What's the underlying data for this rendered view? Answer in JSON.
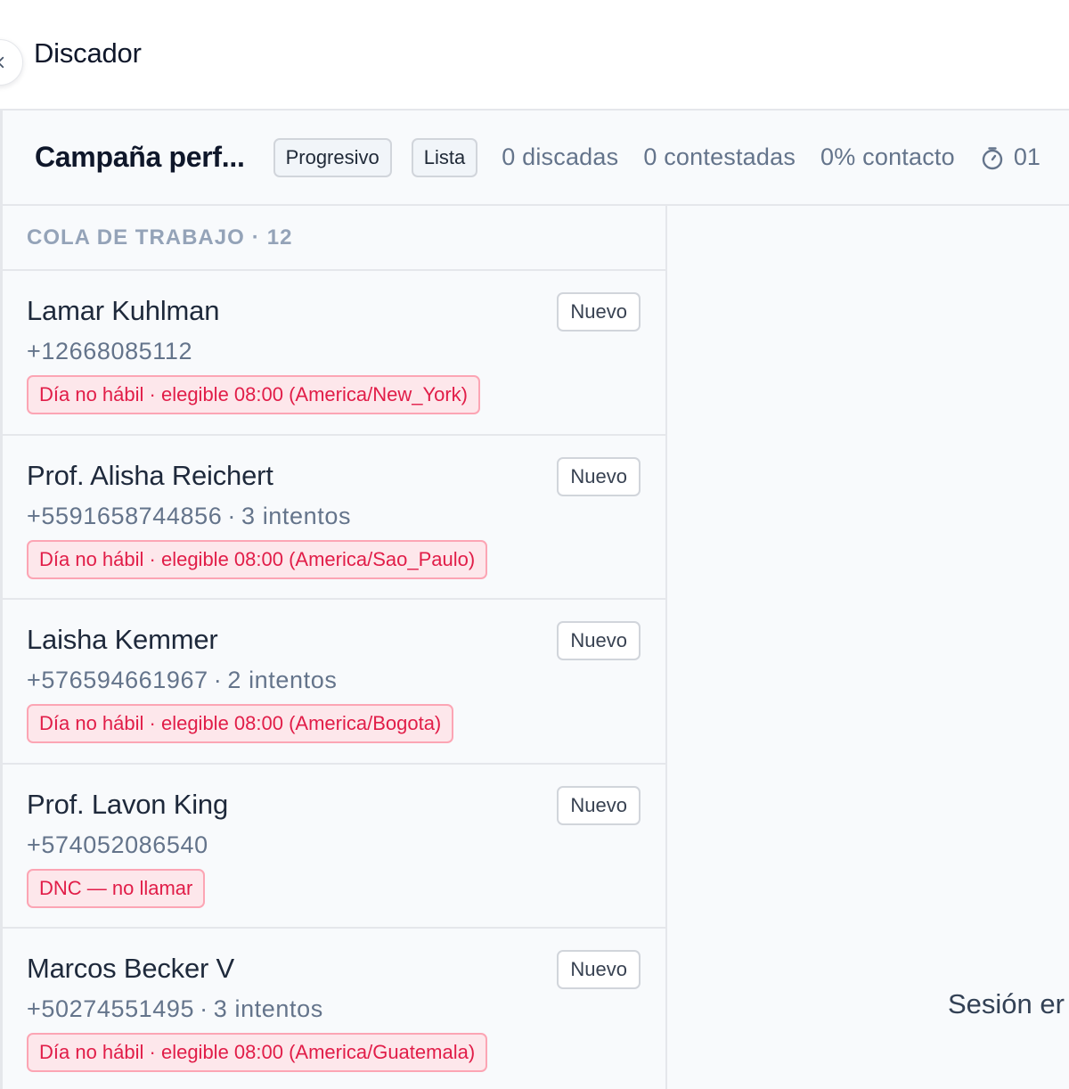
{
  "header": {
    "title": "Discador"
  },
  "campaign": {
    "name": "Campaña perf...",
    "mode": "Progresivo",
    "type": "Lista",
    "stats": {
      "dialed": "0 discadas",
      "answered": "0 contestadas",
      "contact_rate": "0% contacto",
      "timer": "01"
    }
  },
  "queue": {
    "title": "COLA DE TRABAJO",
    "separator": "·",
    "count": "12",
    "items": [
      {
        "name": "Lamar Kuhlman",
        "phone": "+12668085112",
        "attempts": "",
        "status": "Nuevo",
        "alert": "Día no hábil · elegible 08:00 (America/New_York)"
      },
      {
        "name": "Prof. Alisha Reichert",
        "phone": "+5591658744856",
        "attempts": "3 intentos",
        "status": "Nuevo",
        "alert": "Día no hábil · elegible 08:00 (America/Sao_Paulo)"
      },
      {
        "name": "Laisha Kemmer",
        "phone": "+576594661967",
        "attempts": "2 intentos",
        "status": "Nuevo",
        "alert": "Día no hábil · elegible 08:00 (America/Bogota)"
      },
      {
        "name": "Prof. Lavon King",
        "phone": "+574052086540",
        "attempts": "",
        "status": "Nuevo",
        "alert": "DNC — no llamar"
      },
      {
        "name": "Marcos Becker V",
        "phone": "+50274551495",
        "attempts": "3 intentos",
        "status": "Nuevo",
        "alert": "Día no hábil · elegible 08:00 (America/Guatemala)"
      }
    ]
  },
  "detail": {
    "session_text": "Sesión er"
  },
  "icons": {
    "collapse": "chevron-left-icon",
    "timer": "stopwatch-icon"
  },
  "colors": {
    "alert_text": "#e11d48",
    "alert_bg": "#fde7eb",
    "alert_border": "#fca5b4",
    "muted_text": "#64748b"
  }
}
